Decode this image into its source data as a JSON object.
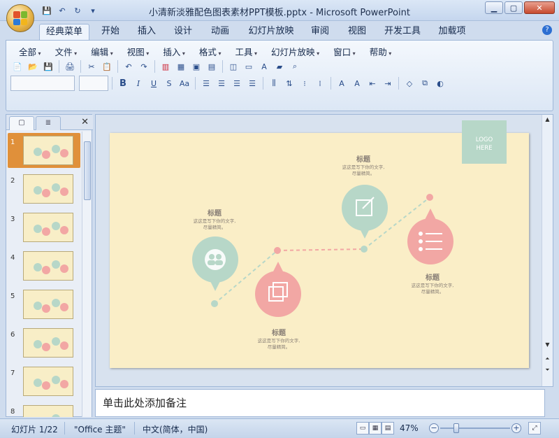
{
  "window": {
    "title": "小清新淡雅配色图表素材PPT模板.pptx - Microsoft PowerPoint",
    "controls": {
      "minimize": "▁",
      "maximize": "▢",
      "close": "✕"
    }
  },
  "quick_access": [
    "💾",
    "↶",
    "↻",
    "▾"
  ],
  "tabs": [
    "经典菜单",
    "开始",
    "插入",
    "设计",
    "动画",
    "幻灯片放映",
    "审阅",
    "视图",
    "开发工具",
    "加载项"
  ],
  "active_tab": "经典菜单",
  "help_label": "?",
  "menus": [
    "全部",
    "文件",
    "编辑",
    "视图",
    "插入",
    "格式",
    "工具",
    "幻灯片放映",
    "窗口",
    "帮助"
  ],
  "toolbar": {
    "row1": [
      "📄",
      "📂",
      "💾",
      "🖨",
      "✂",
      "📋",
      "↶",
      "↷"
    ],
    "format": {
      "bold": "B",
      "italic": "I",
      "underline": "U",
      "strike": "S",
      "case": "Aa"
    }
  },
  "pane": {
    "tab_slides_icon": "slides-icon",
    "tab_outline_icon": "outline-icon",
    "close": "✕"
  },
  "slides": [
    {
      "num": "1",
      "selected": true
    },
    {
      "num": "2",
      "selected": false
    },
    {
      "num": "3",
      "selected": false
    },
    {
      "num": "4",
      "selected": false
    },
    {
      "num": "5",
      "selected": false
    },
    {
      "num": "6",
      "selected": false
    },
    {
      "num": "7",
      "selected": false
    },
    {
      "num": "8",
      "selected": false
    }
  ],
  "slide": {
    "logo_line1": "LOGO",
    "logo_line2": "HERE",
    "points": [
      {
        "title": "标题",
        "desc1": "这这是写下你的文字,",
        "desc2": "尽量精简。",
        "color": "#b7d7c8",
        "icon": "people-icon"
      },
      {
        "title": "标题",
        "desc1": "这这是写下你的文字,",
        "desc2": "尽量精简。",
        "color": "#f2a7a4",
        "icon": "squares-icon"
      },
      {
        "title": "标题",
        "desc1": "这这是写下你的文字,",
        "desc2": "尽量精简。",
        "color": "#b7d7c8",
        "icon": "edit-icon"
      },
      {
        "title": "标题",
        "desc1": "这这是写下你的文字,",
        "desc2": "尽量精简。",
        "color": "#f2a7a4",
        "icon": "list-icon"
      }
    ]
  },
  "notes_placeholder": "单击此处添加备注",
  "status": {
    "slide_info": "幻灯片 1/22",
    "theme": "\"Office 主题\"",
    "language": "中文(简体，中国)",
    "zoom": "47%",
    "zoom_fraction": 0.47
  },
  "colors": {
    "mint": "#b7d7c8",
    "pink": "#f2a7a4",
    "slide_bg": "#faeec7",
    "accent_orange": "#e0903a"
  }
}
